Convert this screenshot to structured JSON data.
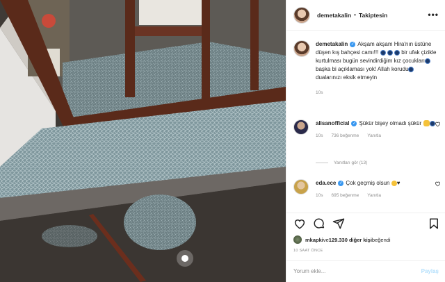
{
  "photo": {
    "alt": "",
    "colors": {
      "wood": "#5a2a1a",
      "glass": "#8fa7ad",
      "floor": "#4a4440"
    }
  },
  "header": {
    "username": "demetakalin",
    "separator": "•",
    "follow_label": "Takiptesin",
    "more_label": "•••"
  },
  "caption": {
    "username": "demetakalin",
    "text_1": "Akşam akşam Hira'nın üstüne düşen kış bahçesi camı!!!",
    "text_2": "bir ufak çizikle kurtulması bugün sevindirdiğim kız çocukları",
    "text_3": "başka bi açıklaması yok! Allah korudu",
    "text_4": "dualarınızı eksik etmeyin",
    "time": "10s"
  },
  "comments": [
    {
      "username": "alisanofficial",
      "text": "Şükür bişey olmadı şükür",
      "time": "10s",
      "likes": "736 beğenme",
      "reply": "Yanıtla"
    },
    {
      "username": "eda.ece",
      "text": "Çok geçmiş olsun",
      "emoji_tail": "♥",
      "time": "10s",
      "likes": "695 beğenme",
      "reply": "Yanıtla"
    }
  ],
  "replies_label": "Yanıtları gör (13)",
  "likes": {
    "user": "mkapki",
    "middle": " ve ",
    "count": "129.330 diğer kişi",
    "suffix": " beğendi"
  },
  "time_ago": "10 SAAT ÖNCE",
  "add_comment": {
    "placeholder": "Yorum ekle...",
    "send_label": "Paylaş"
  }
}
